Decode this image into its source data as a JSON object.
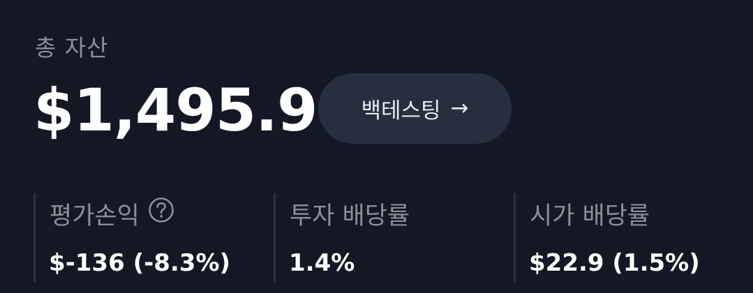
{
  "summary": {
    "total_label": "총 자산",
    "total_value": "$1,495.9",
    "backtest_label": "백테스팅",
    "backtest_arrow": "→"
  },
  "stats": [
    {
      "label": "평가손익",
      "value": "$-136 (-8.3%)",
      "help_icon": "question-circle-icon"
    },
    {
      "label": "투자 배당률",
      "value": "1.4%"
    },
    {
      "label": "시가 배당률",
      "value": "$22.9 (1.5%)"
    }
  ],
  "colors": {
    "background": "#141824",
    "button_bg": "#262e40",
    "muted_text": "#8a8f99",
    "divider": "#2b3140"
  }
}
